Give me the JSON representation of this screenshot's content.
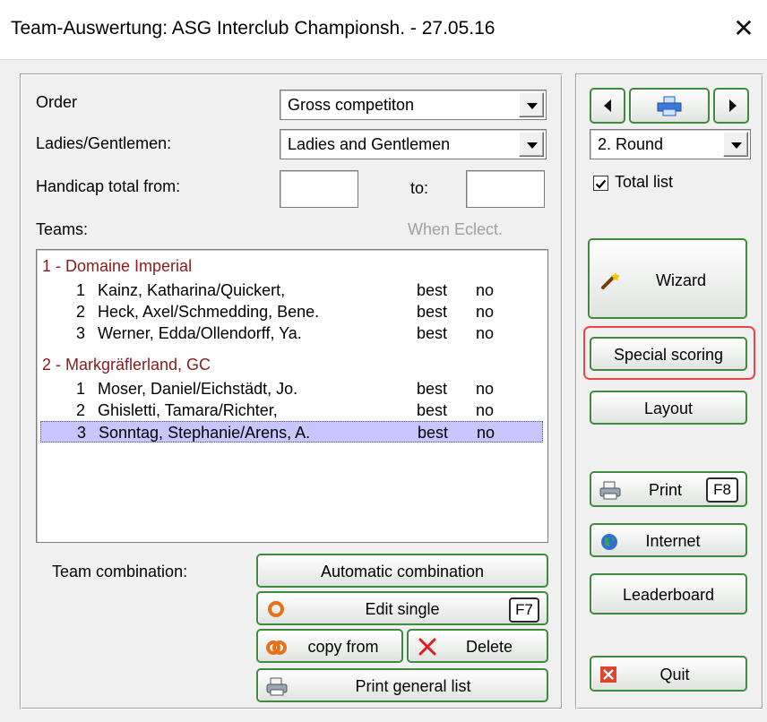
{
  "window": {
    "title": "Team-Auswertung: ASG Interclub Championsh. - 27.05.16",
    "close_glyph": "✕"
  },
  "filters": {
    "order_label": "Order",
    "order_value": "Gross competiton",
    "gender_label": "Ladies/Gentlemen:",
    "gender_value": "Ladies and Gentlemen",
    "handicap_label": "Handicap total from:",
    "handicap_from": "",
    "handicap_to_label": "to:",
    "handicap_to": ""
  },
  "teams": {
    "label": "Teams:",
    "when_eclect": "When Eclect.",
    "groups": [
      {
        "name": "1 - Domaine Imperial",
        "members": [
          {
            "num": "1",
            "name": "Kainz, Katharina/Quickert,",
            "col1": "best",
            "col2": "no",
            "selected": false
          },
          {
            "num": "2",
            "name": "Heck, Axel/Schmedding, Bene.",
            "col1": "best",
            "col2": "no",
            "selected": false
          },
          {
            "num": "3",
            "name": "Werner, Edda/Ollendorff, Ya.",
            "col1": "best",
            "col2": "no",
            "selected": false
          }
        ]
      },
      {
        "name": "2 - Markgräflerland, GC",
        "members": [
          {
            "num": "1",
            "name": "Moser, Daniel/Eichstädt, Jo.",
            "col1": "best",
            "col2": "no",
            "selected": false
          },
          {
            "num": "2",
            "name": "Ghisletti, Tamara/Richter,",
            "col1": "best",
            "col2": "no",
            "selected": false
          },
          {
            "num": "3",
            "name": "Sonntag, Stephanie/Arens, A.",
            "col1": "best",
            "col2": "no",
            "selected": true
          }
        ]
      }
    ]
  },
  "combination": {
    "label": "Team combination:",
    "automatic": "Automatic combination",
    "edit_single": "Edit single",
    "edit_single_key": "F7",
    "copy_from": "copy from",
    "delete": "Delete",
    "print_general": "Print general list"
  },
  "sidebar": {
    "round_value": "2. Round",
    "total_list_label": "Total list",
    "total_list_checked": true,
    "wizard": "Wizard",
    "special_scoring": "Special scoring",
    "layout": "Layout",
    "print": "Print",
    "print_key": "F8",
    "internet": "Internet",
    "leaderboard": "Leaderboard",
    "quit": "Quit"
  },
  "colors": {
    "group_text": "#8b1a1a",
    "button_border": "#3e8a3e",
    "selection": "#c9c6ff",
    "highlight": "#e8474a"
  }
}
